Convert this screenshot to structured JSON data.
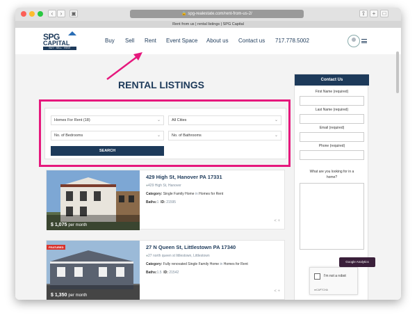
{
  "browser": {
    "url": "spg-realestate.com/rent-from-us-2/",
    "tab_title": "Rent from us | rental listings | SPG Capital"
  },
  "logo": {
    "line1": "SPG",
    "line2": "CAPITAL",
    "tagline": "BUY · SELL · RENT"
  },
  "nav": {
    "items": [
      "Buy",
      "Sell",
      "Rent",
      "Event Space",
      "About us",
      "Contact us"
    ],
    "phone": "717.778.5002"
  },
  "page_title": "RENTAL LISTINGS",
  "filters": {
    "type": "Homes For Rent (18)",
    "cities": "All Cities",
    "bedrooms": "No. of Bedrooms",
    "bathrooms": "No. of Bathrooms",
    "search_label": "SEARCH"
  },
  "listings": [
    {
      "title": "429 High St, Hanover PA 17331",
      "address": "429 High St, Hanover",
      "category_label": "Category:",
      "category": "Single Family Home",
      "in_word": "in",
      "collection": "Homes for Rent",
      "baths_label": "Baths:",
      "baths": "1",
      "id_label": "ID:",
      "id": "21595",
      "price": "$ 1,075",
      "price_suffix": "per month",
      "featured": ""
    },
    {
      "title": "27 N Queen St, Littlestown PA 17340",
      "address": "27 north queen st littlestown, Littlestown",
      "category_label": "Category:",
      "category": "Fully renovated Single Family Home",
      "in_word": "in",
      "collection": "Homes for Rent",
      "baths_label": "Baths:",
      "baths": "1.5",
      "id_label": "ID:",
      "id": "21542",
      "price": "$ 1,350",
      "price_suffix": "per month",
      "featured": "FEATURED"
    }
  ],
  "contact": {
    "header": "Contact Us",
    "first_name": "First Name (required)",
    "last_name": "Last Name (required)",
    "email": "Email (required)",
    "phone": "Phone (required)",
    "looking_for": "What are you looking for in a home?",
    "captcha": "I'm not a robot",
    "captcha_brand": "reCAPTCHA"
  },
  "ga_badge": "Google Analytics",
  "colors": {
    "brand": "#1d3a5a",
    "highlight": "#e6187d",
    "featured": "#d8332c"
  }
}
